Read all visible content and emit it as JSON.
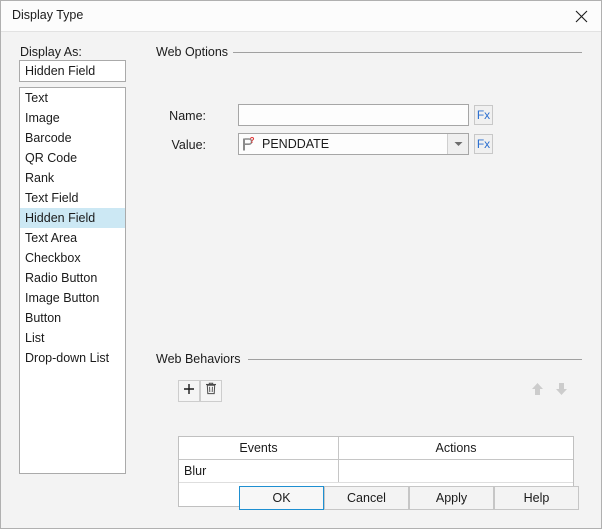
{
  "window": {
    "title": "Display Type",
    "close_icon": "close-icon"
  },
  "left_panel": {
    "display_as_label": "Display As:",
    "display_as_value": "Hidden Field",
    "items": [
      "Text",
      "Image",
      "Barcode",
      "QR Code",
      "Rank",
      "Text Field",
      "Hidden Field",
      "Text Area",
      "Checkbox",
      "Radio Button",
      "Image Button",
      "Button",
      "List",
      "Drop-down List"
    ],
    "selected_index": 6,
    "selection_color": "#cce8f4"
  },
  "web_options": {
    "group_label": "Web Options",
    "name_label": "Name:",
    "name_value": "",
    "name_placeholder": "",
    "name_fx_label": "Fx",
    "value_label": "Value:",
    "value_value": "PENDDATE",
    "value_icon": "parameter-icon",
    "value_fx_label": "Fx",
    "dropdown_icon": "chevron-down-icon",
    "fx_color": "#2b6fd0"
  },
  "web_behaviors": {
    "group_label": "Web Behaviors",
    "add_icon": "plus-icon",
    "delete_icon": "trash-icon",
    "move_up_icon": "arrow-up-icon",
    "move_down_icon": "arrow-down-icon",
    "columns": [
      "Events",
      "Actions"
    ],
    "rows": [
      {
        "event": "Blur",
        "action": ""
      }
    ]
  },
  "footer": {
    "ok": "OK",
    "cancel": "Cancel",
    "apply": "Apply",
    "help": "Help",
    "default_button": "OK",
    "focus_color": "#1e8fd1"
  }
}
